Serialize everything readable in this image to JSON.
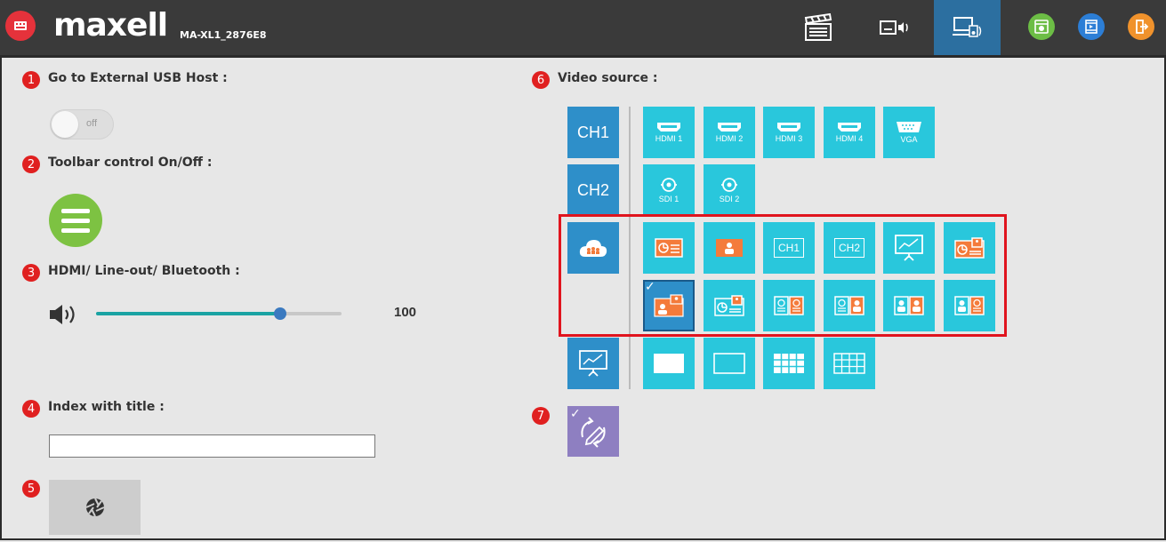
{
  "header": {
    "brand": "maxell",
    "device_name": "MA-XL1_2876E8",
    "icons": [
      "app-icon",
      "clapper-icon",
      "screen-audio-icon",
      "monitor-speaker-icon",
      "settings-icon",
      "film-icon",
      "exit-icon"
    ],
    "accent_active": "#2c6fa0"
  },
  "sections": {
    "usb": {
      "number": "1",
      "label": "Go to External USB Host :",
      "toggle_text": "off",
      "toggle_state": "off"
    },
    "toolbar": {
      "number": "2",
      "label": "Toolbar control On/Off :"
    },
    "audio": {
      "number": "3",
      "label": "HDMI/ Line-out/ Bluetooth :",
      "volume": "100",
      "volume_level": 0.75
    },
    "index": {
      "number": "4",
      "label": "Index with title :",
      "value": ""
    },
    "capture": {
      "number": "5"
    },
    "video": {
      "number": "6",
      "label": "Video source :"
    },
    "sync": {
      "number": "7"
    }
  },
  "video_sources": {
    "ch1": {
      "label": "CH1",
      "inputs": [
        "HDMI 1",
        "HDMI 2",
        "HDMI 3",
        "HDMI 4",
        "VGA"
      ]
    },
    "ch2": {
      "label": "CH2",
      "inputs": [
        "SDI 1",
        "SDI 2"
      ]
    },
    "layout_labels": {
      "ch1": "CH1",
      "ch2": "CH2"
    }
  },
  "colors": {
    "tile": "#29c7dc",
    "tile_blue": "#2e8fc9",
    "highlight": "#e0141e",
    "badge": "#e02020",
    "green": "#7dc242"
  }
}
